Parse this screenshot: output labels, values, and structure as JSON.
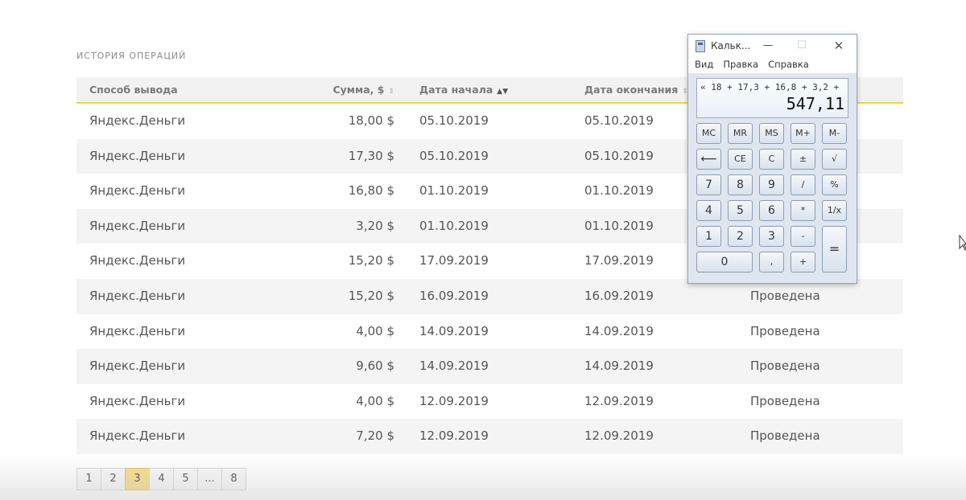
{
  "history": {
    "title": "ИСТОРИЯ ОПЕРАЦИЙ",
    "columns": {
      "method": "Способ вывода",
      "sum": "Сумма, $",
      "start": "Дата начала",
      "end": "Дата окончания",
      "sort_icon_default": "⇕",
      "sort_icon_active": "▲▼"
    },
    "rows": [
      {
        "method": "Яндекс.Деньги",
        "sum": "18,00 $",
        "start": "05.10.2019",
        "end": "05.10.2019",
        "status": ""
      },
      {
        "method": "Яндекс.Деньги",
        "sum": "17,30 $",
        "start": "05.10.2019",
        "end": "05.10.2019",
        "status": ""
      },
      {
        "method": "Яндекс.Деньги",
        "sum": "16,80 $",
        "start": "01.10.2019",
        "end": "01.10.2019",
        "status": ""
      },
      {
        "method": "Яндекс.Деньги",
        "sum": "3,20 $",
        "start": "01.10.2019",
        "end": "01.10.2019",
        "status": ""
      },
      {
        "method": "Яндекс.Деньги",
        "sum": "15,20 $",
        "start": "17.09.2019",
        "end": "17.09.2019",
        "status": ""
      },
      {
        "method": "Яндекс.Деньги",
        "sum": "15,20 $",
        "start": "16.09.2019",
        "end": "16.09.2019",
        "status": "Проведена"
      },
      {
        "method": "Яндекс.Деньги",
        "sum": "4,00 $",
        "start": "14.09.2019",
        "end": "14.09.2019",
        "status": "Проведена"
      },
      {
        "method": "Яндекс.Деньги",
        "sum": "9,60 $",
        "start": "14.09.2019",
        "end": "14.09.2019",
        "status": "Проведена"
      },
      {
        "method": "Яндекс.Деньги",
        "sum": "4,00 $",
        "start": "12.09.2019",
        "end": "12.09.2019",
        "status": "Проведена"
      },
      {
        "method": "Яндекс.Деньги",
        "sum": "7,20 $",
        "start": "12.09.2019",
        "end": "12.09.2019",
        "status": "Проведена"
      }
    ]
  },
  "pagination": {
    "pages": [
      "1",
      "2",
      "3",
      "4",
      "5",
      "...",
      "8"
    ],
    "active": "3"
  },
  "calculator": {
    "title": "Кальк...",
    "window_buttons": {
      "minimize": "—",
      "maximize": "☐",
      "close": "✕"
    },
    "menu": [
      "Вид",
      "Правка",
      "Справка"
    ],
    "expression": "« 18 + 17,3 + 16,8 + 3,2 +",
    "result": "547,11",
    "keys": {
      "mc": "MC",
      "mr": "MR",
      "ms": "MS",
      "mplus": "M+",
      "mminus": "M-",
      "backspace": "⟵",
      "ce": "CE",
      "c": "C",
      "plusminus": "±",
      "sqrt": "√",
      "k7": "7",
      "k8": "8",
      "k9": "9",
      "divide": "/",
      "percent": "%",
      "k4": "4",
      "k5": "5",
      "k6": "6",
      "multiply": "*",
      "reciprocal": "1/x",
      "k1": "1",
      "k2": "2",
      "k3": "3",
      "minus": "-",
      "equals": "=",
      "k0": "0",
      "comma": ",",
      "plus": "+"
    }
  },
  "colors": {
    "accent_yellow": "#f5d43a",
    "active_page": "#f7dc8a",
    "row_alt": "#f4f4f4"
  }
}
